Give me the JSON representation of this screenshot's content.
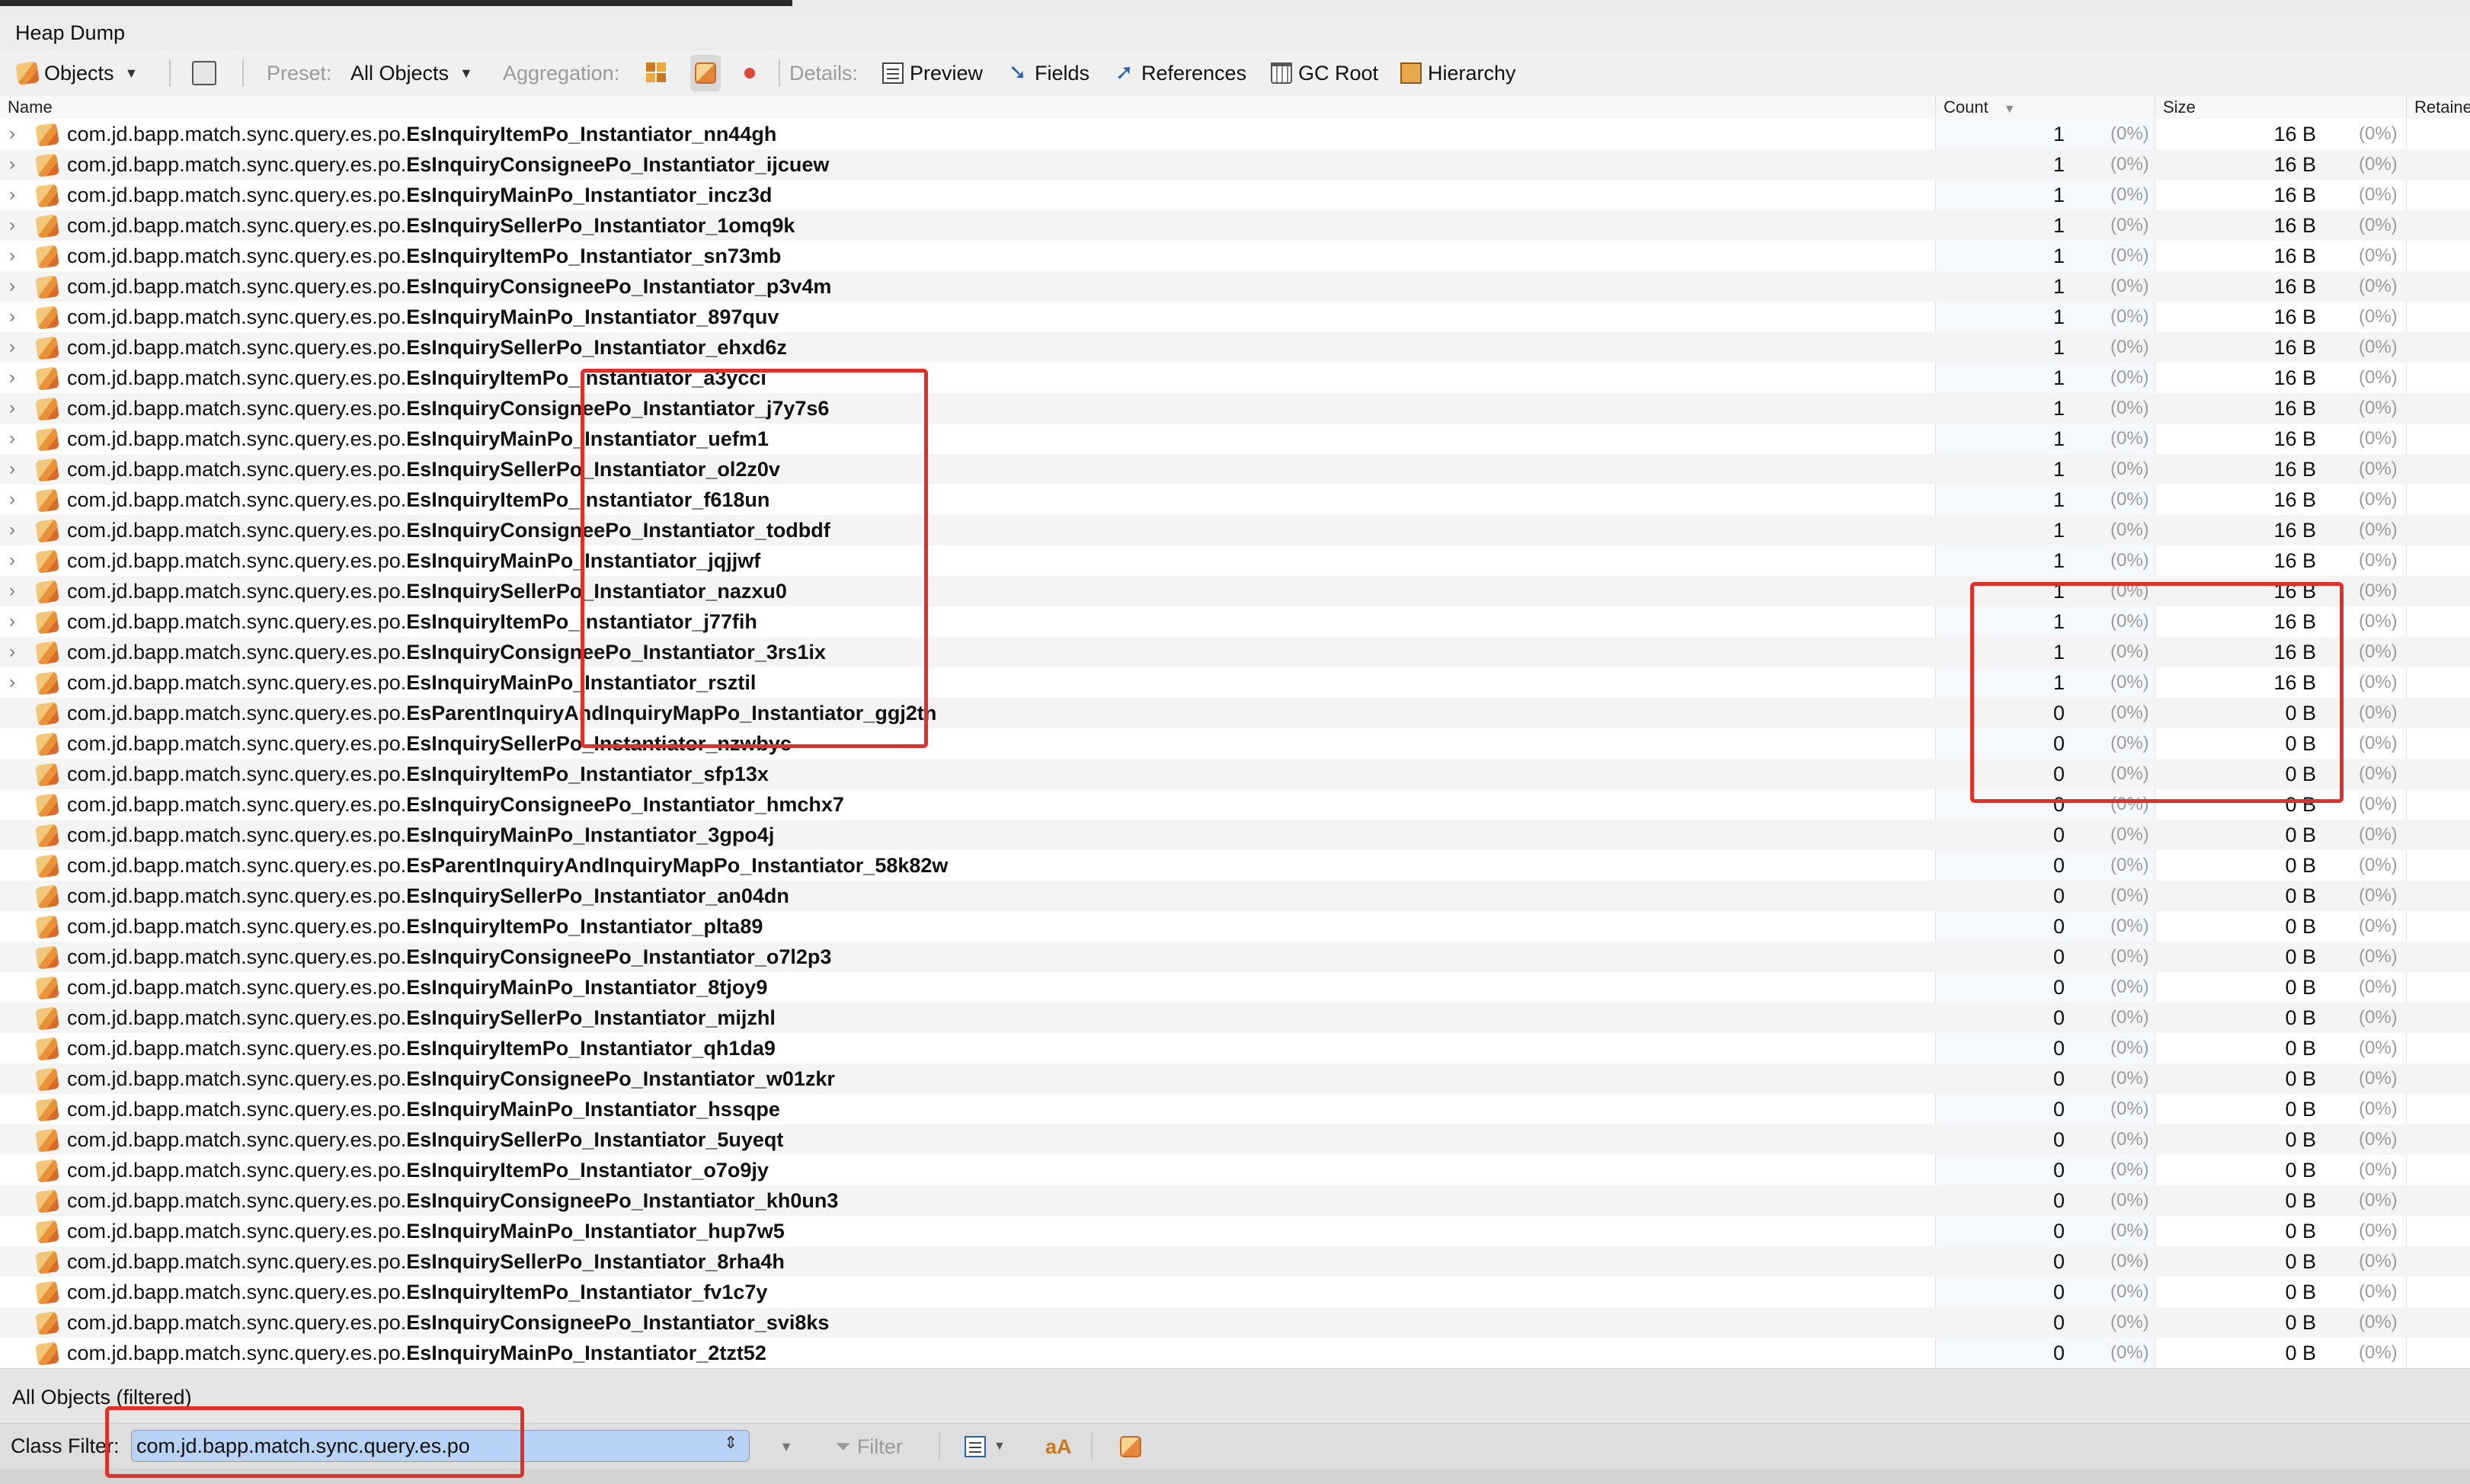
{
  "window": {
    "panel_title": "Heap Dump"
  },
  "toolbar": {
    "view_selector": "Objects",
    "preset_label": "Preset:",
    "preset_value": "All Objects",
    "aggregation_label": "Aggregation:",
    "details_label": "Details:",
    "preview": "Preview",
    "fields": "Fields",
    "references": "References",
    "gc_root": "GC Root",
    "hierarchy": "Hierarchy"
  },
  "columns": {
    "name": "Name",
    "count": "Count",
    "size": "Size",
    "retained": "Retainec"
  },
  "package_prefix": "com.jd.bapp.match.sync.query.es.po.",
  "rows": [
    {
      "cls": "EsInquiryItemPo_Instantiator_nn44gh",
      "count": "1",
      "cpct": "(0%)",
      "size": "16 B",
      "spct": "(0%)"
    },
    {
      "cls": "EsInquiryConsigneePo_Instantiator_ijcuew",
      "count": "1",
      "cpct": "(0%)",
      "size": "16 B",
      "spct": "(0%)"
    },
    {
      "cls": "EsInquiryMainPo_Instantiator_incz3d",
      "count": "1",
      "cpct": "(0%)",
      "size": "16 B",
      "spct": "(0%)"
    },
    {
      "cls": "EsInquirySellerPo_Instantiator_1omq9k",
      "count": "1",
      "cpct": "(0%)",
      "size": "16 B",
      "spct": "(0%)"
    },
    {
      "cls": "EsInquiryItemPo_Instantiator_sn73mb",
      "count": "1",
      "cpct": "(0%)",
      "size": "16 B",
      "spct": "(0%)"
    },
    {
      "cls": "EsInquiryConsigneePo_Instantiator_p3v4m",
      "count": "1",
      "cpct": "(0%)",
      "size": "16 B",
      "spct": "(0%)"
    },
    {
      "cls": "EsInquiryMainPo_Instantiator_897quv",
      "count": "1",
      "cpct": "(0%)",
      "size": "16 B",
      "spct": "(0%)"
    },
    {
      "cls": "EsInquirySellerPo_Instantiator_ehxd6z",
      "count": "1",
      "cpct": "(0%)",
      "size": "16 B",
      "spct": "(0%)"
    },
    {
      "cls": "EsInquiryItemPo_Instantiator_a3ycci",
      "count": "1",
      "cpct": "(0%)",
      "size": "16 B",
      "spct": "(0%)"
    },
    {
      "cls": "EsInquiryConsigneePo_Instantiator_j7y7s6",
      "count": "1",
      "cpct": "(0%)",
      "size": "16 B",
      "spct": "(0%)"
    },
    {
      "cls": "EsInquiryMainPo_Instantiator_uefm1",
      "count": "1",
      "cpct": "(0%)",
      "size": "16 B",
      "spct": "(0%)"
    },
    {
      "cls": "EsInquirySellerPo_Instantiator_ol2z0v",
      "count": "1",
      "cpct": "(0%)",
      "size": "16 B",
      "spct": "(0%)"
    },
    {
      "cls": "EsInquiryItemPo_Instantiator_f618un",
      "count": "1",
      "cpct": "(0%)",
      "size": "16 B",
      "spct": "(0%)"
    },
    {
      "cls": "EsInquiryConsigneePo_Instantiator_todbdf",
      "count": "1",
      "cpct": "(0%)",
      "size": "16 B",
      "spct": "(0%)"
    },
    {
      "cls": "EsInquiryMainPo_Instantiator_jqjjwf",
      "count": "1",
      "cpct": "(0%)",
      "size": "16 B",
      "spct": "(0%)"
    },
    {
      "cls": "EsInquirySellerPo_Instantiator_nazxu0",
      "count": "1",
      "cpct": "(0%)",
      "size": "16 B",
      "spct": "(0%)"
    },
    {
      "cls": "EsInquiryItemPo_Instantiator_j77fih",
      "count": "1",
      "cpct": "(0%)",
      "size": "16 B",
      "spct": "(0%)"
    },
    {
      "cls": "EsInquiryConsigneePo_Instantiator_3rs1ix",
      "count": "1",
      "cpct": "(0%)",
      "size": "16 B",
      "spct": "(0%)"
    },
    {
      "cls": "EsInquiryMainPo_Instantiator_rsztil",
      "count": "1",
      "cpct": "(0%)",
      "size": "16 B",
      "spct": "(0%)"
    },
    {
      "cls": "EsParentInquiryAndInquiryMapPo_Instantiator_ggj2tn",
      "count": "0",
      "cpct": "(0%)",
      "size": "0 B",
      "spct": "(0%)"
    },
    {
      "cls": "EsInquirySellerPo_Instantiator_nzwbyc",
      "count": "0",
      "cpct": "(0%)",
      "size": "0 B",
      "spct": "(0%)"
    },
    {
      "cls": "EsInquiryItemPo_Instantiator_sfp13x",
      "count": "0",
      "cpct": "(0%)",
      "size": "0 B",
      "spct": "(0%)"
    },
    {
      "cls": "EsInquiryConsigneePo_Instantiator_hmchx7",
      "count": "0",
      "cpct": "(0%)",
      "size": "0 B",
      "spct": "(0%)"
    },
    {
      "cls": "EsInquiryMainPo_Instantiator_3gpo4j",
      "count": "0",
      "cpct": "(0%)",
      "size": "0 B",
      "spct": "(0%)"
    },
    {
      "cls": "EsParentInquiryAndInquiryMapPo_Instantiator_58k82w",
      "count": "0",
      "cpct": "(0%)",
      "size": "0 B",
      "spct": "(0%)"
    },
    {
      "cls": "EsInquirySellerPo_Instantiator_an04dn",
      "count": "0",
      "cpct": "(0%)",
      "size": "0 B",
      "spct": "(0%)"
    },
    {
      "cls": "EsInquiryItemPo_Instantiator_plta89",
      "count": "0",
      "cpct": "(0%)",
      "size": "0 B",
      "spct": "(0%)"
    },
    {
      "cls": "EsInquiryConsigneePo_Instantiator_o7l2p3",
      "count": "0",
      "cpct": "(0%)",
      "size": "0 B",
      "spct": "(0%)"
    },
    {
      "cls": "EsInquiryMainPo_Instantiator_8tjoy9",
      "count": "0",
      "cpct": "(0%)",
      "size": "0 B",
      "spct": "(0%)"
    },
    {
      "cls": "EsInquirySellerPo_Instantiator_mijzhl",
      "count": "0",
      "cpct": "(0%)",
      "size": "0 B",
      "spct": "(0%)"
    },
    {
      "cls": "EsInquiryItemPo_Instantiator_qh1da9",
      "count": "0",
      "cpct": "(0%)",
      "size": "0 B",
      "spct": "(0%)"
    },
    {
      "cls": "EsInquiryConsigneePo_Instantiator_w01zkr",
      "count": "0",
      "cpct": "(0%)",
      "size": "0 B",
      "spct": "(0%)"
    },
    {
      "cls": "EsInquiryMainPo_Instantiator_hssqpe",
      "count": "0",
      "cpct": "(0%)",
      "size": "0 B",
      "spct": "(0%)"
    },
    {
      "cls": "EsInquirySellerPo_Instantiator_5uyeqt",
      "count": "0",
      "cpct": "(0%)",
      "size": "0 B",
      "spct": "(0%)"
    },
    {
      "cls": "EsInquiryItemPo_Instantiator_o7o9jy",
      "count": "0",
      "cpct": "(0%)",
      "size": "0 B",
      "spct": "(0%)"
    },
    {
      "cls": "EsInquiryConsigneePo_Instantiator_kh0un3",
      "count": "0",
      "cpct": "(0%)",
      "size": "0 B",
      "spct": "(0%)"
    },
    {
      "cls": "EsInquiryMainPo_Instantiator_hup7w5",
      "count": "0",
      "cpct": "(0%)",
      "size": "0 B",
      "spct": "(0%)"
    },
    {
      "cls": "EsInquirySellerPo_Instantiator_8rha4h",
      "count": "0",
      "cpct": "(0%)",
      "size": "0 B",
      "spct": "(0%)"
    },
    {
      "cls": "EsInquiryItemPo_Instantiator_fv1c7y",
      "count": "0",
      "cpct": "(0%)",
      "size": "0 B",
      "spct": "(0%)"
    },
    {
      "cls": "EsInquiryConsigneePo_Instantiator_svi8ks",
      "count": "0",
      "cpct": "(0%)",
      "size": "0 B",
      "spct": "(0%)"
    },
    {
      "cls": "EsInquiryMainPo_Instantiator_2tzt52",
      "count": "0",
      "cpct": "(0%)",
      "size": "0 B",
      "spct": "(0%)"
    }
  ],
  "status": {
    "text": "All Objects (filtered)"
  },
  "filter": {
    "label": "Class Filter:",
    "value": "com.jd.bapp.match.sync.query.es.po",
    "button": "Filter"
  },
  "colors": {
    "highlight": "#e0302a",
    "selection": "#b7d2f6"
  }
}
